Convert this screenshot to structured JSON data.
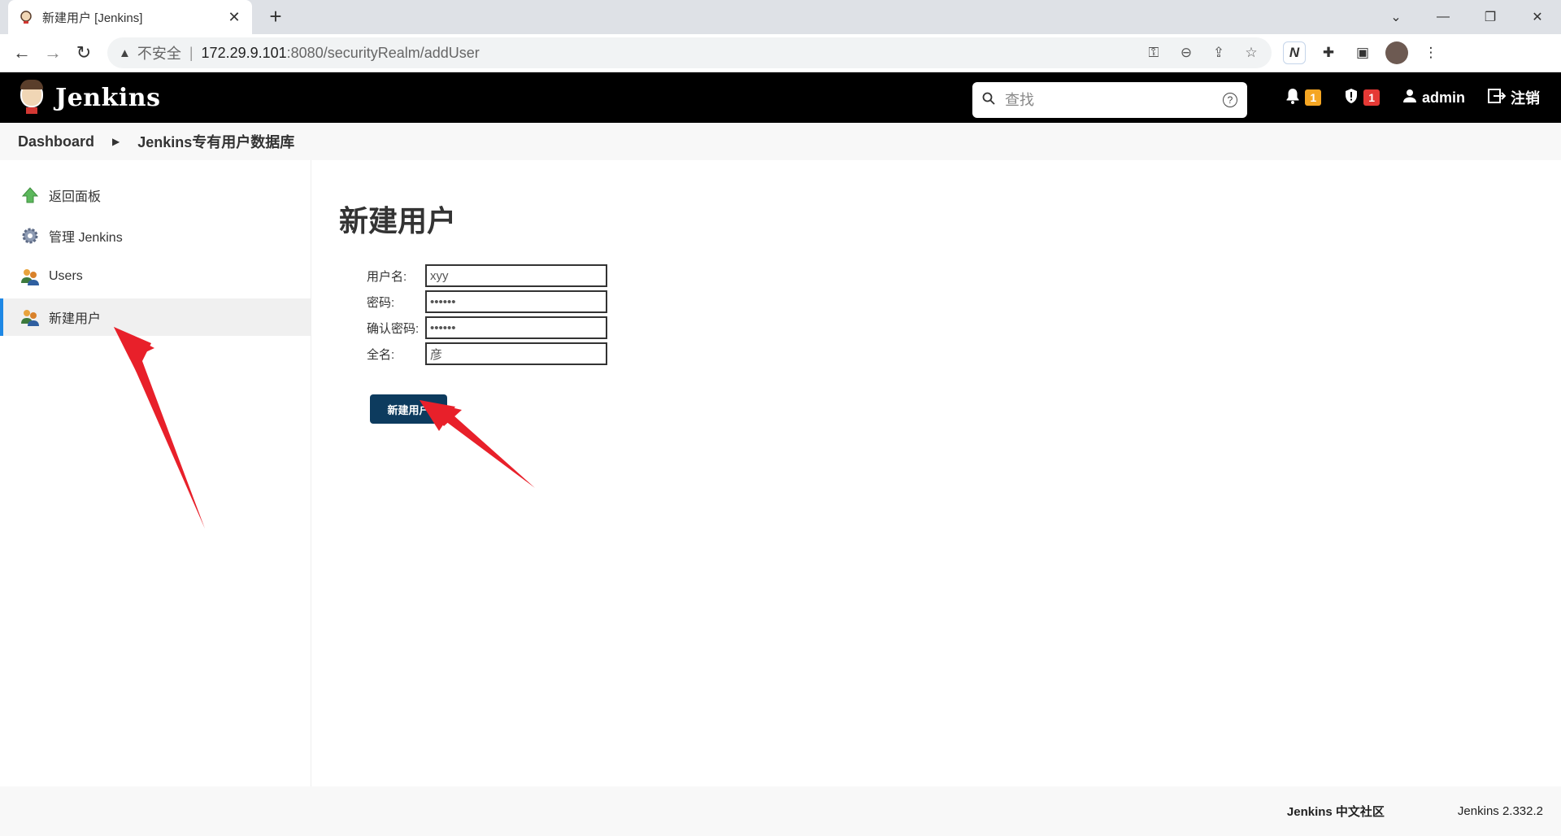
{
  "browser": {
    "tab_title": "新建用户 [Jenkins]",
    "tab_close": "✕",
    "new_tab": "+",
    "insecure_label": "不安全",
    "url_host": "172.29.9.101",
    "url_path": ":8080/securityRealm/addUser",
    "window_controls": {
      "minimize": "—",
      "maximize": "❐",
      "close": "✕",
      "tab_list": "⌄"
    }
  },
  "header": {
    "brand": "Jenkins",
    "search_placeholder": "查找",
    "notifications_count": "1",
    "security_count": "1",
    "user": "admin",
    "logout": "注销"
  },
  "breadcrumb": {
    "items": [
      "Dashboard",
      "Jenkins专有用户数据库"
    ]
  },
  "sidebar": {
    "items": [
      {
        "label": "返回面板",
        "icon": "up-arrow-icon"
      },
      {
        "label": "管理 Jenkins",
        "icon": "gear-icon"
      },
      {
        "label": "Users",
        "icon": "users-icon"
      },
      {
        "label": "新建用户",
        "icon": "users-icon"
      }
    ]
  },
  "main": {
    "title": "新建用户",
    "form": {
      "username_label": "用户名:",
      "username_value": "xyy",
      "password_label": "密码:",
      "password_value": "••••••",
      "confirm_label": "确认密码:",
      "confirm_value": "••••••",
      "fullname_label": "全名:",
      "fullname_value": "彦"
    },
    "submit_label": "新建用户"
  },
  "footer": {
    "community": "Jenkins 中文社区",
    "version": "Jenkins 2.332.2"
  },
  "colors": {
    "header_bg": "#000000",
    "primary_button": "#0d3b5e",
    "badge_warning": "#f5a623",
    "badge_danger": "#e53935",
    "active_indicator": "#1e88e5",
    "annotation_arrow": "#e8202a"
  }
}
